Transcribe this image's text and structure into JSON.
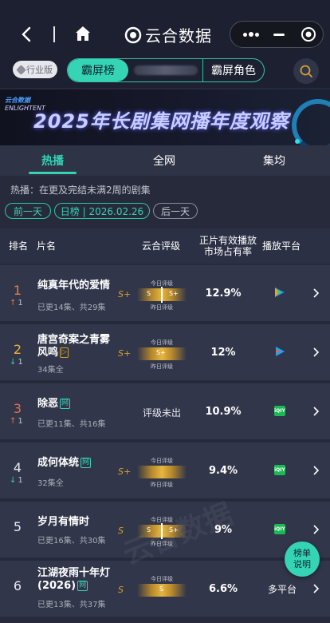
{
  "header": {
    "title": "云合数据",
    "icons": [
      "back-icon",
      "home-icon",
      "more-icon",
      "minimize-icon",
      "target-icon"
    ]
  },
  "category": {
    "industry_label": "行业版",
    "segments": [
      {
        "label": "霸屏榜"
      },
      {
        "label": ""
      },
      {
        "label": "霸屏角色"
      }
    ]
  },
  "banner": {
    "logo_text": "云合数据",
    "logo_sub": "ENLIGHTENT",
    "title": "2025年长剧集网播年度观察"
  },
  "tabs": [
    {
      "label": "热播"
    },
    {
      "label": "全网"
    },
    {
      "label": "集均"
    }
  ],
  "hint": "热播：在更及完结未满2周的剧集",
  "date_nav": {
    "prev": "前一天",
    "current": "日榜 | 2026.02.26",
    "next": "后一天"
  },
  "table_headers": {
    "rank": "排名",
    "name": "片名",
    "grade": "云合评级",
    "share_line1": "正片有效播放",
    "share_line2": "市场占有率",
    "platform": "播放平台"
  },
  "grade_labels": {
    "today": "今日评级",
    "yesterday": "昨日评级",
    "pending": "评级未出"
  },
  "rows": [
    {
      "rank": "1",
      "trend": "up",
      "trend_val": "1",
      "name": "纯真年代的爱情",
      "tag": "",
      "sub": "已更14集、共29集",
      "grade": "S+",
      "grade_left": "S",
      "grade_right": "S+",
      "share": "12.9%",
      "platform": "tencent"
    },
    {
      "rank": "2",
      "trend": "down",
      "trend_val": "1",
      "name": "唐宫奇案之青雾风鸣",
      "tag": "▷",
      "sub": "34集全",
      "grade": "S+",
      "grade_left": "",
      "grade_right": "S+",
      "share": "12%",
      "platform": "youku"
    },
    {
      "rank": "3",
      "trend": "up",
      "trend_val": "1",
      "name": "除恶",
      "tag": "网",
      "sub": "已更11集、共16集",
      "grade": "",
      "grade_left": "",
      "grade_right": "",
      "share": "10.9%",
      "platform": "iqiyi"
    },
    {
      "rank": "4",
      "trend": "down",
      "trend_val": "1",
      "name": "成何体统",
      "tag": "网",
      "sub": "32集全",
      "grade": "S+",
      "grade_left": "",
      "grade_right": "",
      "share": "9.4%",
      "platform": "iqiyi"
    },
    {
      "rank": "5",
      "trend": "",
      "trend_val": "",
      "name": "岁月有情时",
      "tag": "",
      "sub": "已更16集、共30集",
      "grade": "S",
      "grade_left": "S",
      "grade_right": "S+",
      "share": "9%",
      "platform": "iqiyi"
    },
    {
      "rank": "6",
      "trend": "",
      "trend_val": "",
      "name": "江湖夜雨十年灯(2026)",
      "tag": "网",
      "sub": "已更13集、共37集",
      "grade": "S",
      "grade_left": "",
      "grade_right": "",
      "share": "6.6%",
      "platform_text": "多平台"
    }
  ],
  "float_button": "榜单说明",
  "colors": {
    "accent": "#35d4b5",
    "gold": "#d4a02a",
    "up": "#f07a3c",
    "bg": "#262a3b"
  }
}
